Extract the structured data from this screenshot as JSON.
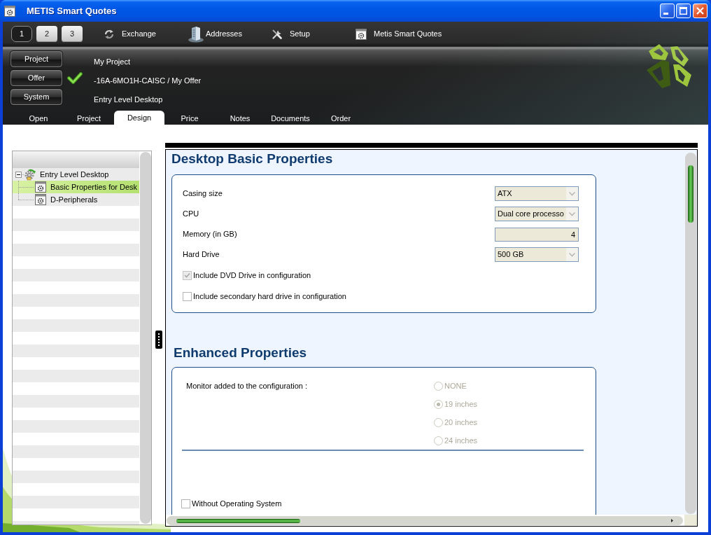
{
  "window": {
    "title": "METIS Smart Quotes"
  },
  "toolbar": {
    "pages": [
      {
        "label": "1",
        "selected": true
      },
      {
        "label": "2",
        "selected": false
      },
      {
        "label": "3",
        "selected": false
      }
    ],
    "items": [
      {
        "kind": "exchange",
        "label": "Exchange"
      },
      {
        "kind": "addresses",
        "label": "Addresses"
      },
      {
        "kind": "setup",
        "label": "Setup"
      },
      {
        "kind": "app",
        "label": "Metis Smart Quotes"
      }
    ]
  },
  "context": [
    {
      "button": "Project",
      "value": "My Project",
      "checked": false
    },
    {
      "button": "Offer",
      "value": "-16A-6MO1H-CAISC / My Offer",
      "checked": true
    },
    {
      "button": "System",
      "value": "Entry Level Desktop",
      "checked": false
    }
  ],
  "tabs": [
    {
      "label": "Open",
      "selected": false
    },
    {
      "label": "Project",
      "selected": false
    },
    {
      "label": "Design",
      "selected": true
    },
    {
      "label": "Price",
      "selected": false
    },
    {
      "label": "Notes",
      "selected": false
    },
    {
      "label": "Documents",
      "selected": false
    },
    {
      "label": "Order",
      "selected": false
    }
  ],
  "tree": [
    {
      "label": "Entry Level Desktop",
      "expanded": true,
      "selected": false,
      "children": [
        {
          "label": "Basic Properties for Desk",
          "selected": true
        },
        {
          "label": "D-Peripherals",
          "selected": false
        }
      ]
    }
  ],
  "sections": [
    {
      "title": "Desktop Basic Properties",
      "fields": [
        {
          "kind": "select",
          "label": "Casing size",
          "value": "ATX",
          "disabled": false
        },
        {
          "kind": "select",
          "label": "CPU",
          "value": "Dual core processo",
          "disabled": false
        },
        {
          "kind": "number",
          "label": "Memory (in GB)",
          "value": "4",
          "disabled": false
        },
        {
          "kind": "select",
          "label": "Hard Drive",
          "value": "500 GB",
          "disabled": false
        },
        {
          "kind": "checkbox",
          "label": "Include DVD Drive in configuration",
          "checked": true,
          "disabled": true
        },
        {
          "kind": "checkbox",
          "label": "Include secondary hard drive in configuration",
          "checked": false,
          "disabled": false
        }
      ]
    },
    {
      "title": "Enhanced Properties",
      "fields": [
        {
          "kind": "radio_group",
          "label": "Monitor added to the configuration :",
          "disabled": true,
          "options": [
            {
              "label": "NONE",
              "selected": false
            },
            {
              "label": "19 inches",
              "selected": true
            },
            {
              "label": "20 inches",
              "selected": false
            },
            {
              "label": "24 inches",
              "selected": false
            }
          ]
        },
        {
          "kind": "checkbox",
          "label": "Without Operating System",
          "checked": false,
          "disabled": false
        }
      ]
    }
  ]
}
